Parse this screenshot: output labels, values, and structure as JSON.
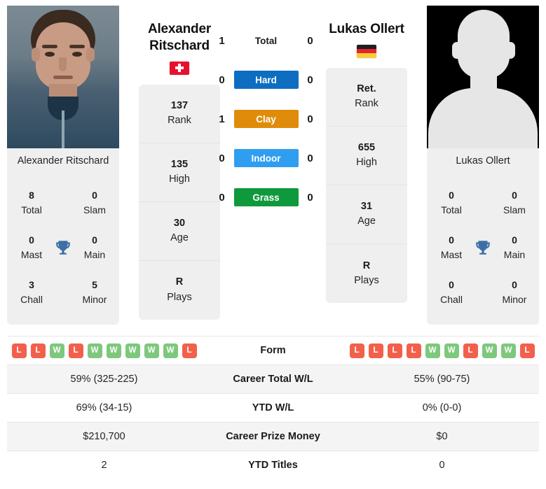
{
  "colors": {
    "hard": "#0d6ec1",
    "clay": "#e08c0a",
    "indoor": "#2f9ef0",
    "grass": "#0e9a3c",
    "win": "#7ec87e",
    "loss": "#f2604c",
    "trophy": "#3d6fa5"
  },
  "player_left": {
    "name_line1": "Alexander",
    "name_line2": "Ritschard",
    "photo_caption": "Alexander Ritschard",
    "flag": "flag-switzerland",
    "stats": [
      {
        "value": "137",
        "label": "Rank"
      },
      {
        "value": "135",
        "label": "High"
      },
      {
        "value": "30",
        "label": "Age"
      },
      {
        "value": "R",
        "label": "Plays"
      }
    ],
    "titles": [
      {
        "value": "8",
        "label": "Total"
      },
      {
        "value": "0",
        "label": "Slam"
      },
      {
        "value": "0",
        "label": "Mast"
      },
      {
        "value": "0",
        "label": "Main"
      },
      {
        "value": "3",
        "label": "Chall"
      },
      {
        "value": "5",
        "label": "Minor"
      }
    ],
    "form": [
      "L",
      "L",
      "W",
      "L",
      "W",
      "W",
      "W",
      "W",
      "W",
      "L"
    ]
  },
  "player_right": {
    "name_line1": "Lukas Ollert",
    "name_line2": "",
    "photo_caption": "Lukas Ollert",
    "flag": "flag-germany",
    "stats": [
      {
        "value": "Ret.",
        "label": "Rank"
      },
      {
        "value": "655",
        "label": "High"
      },
      {
        "value": "31",
        "label": "Age"
      },
      {
        "value": "R",
        "label": "Plays"
      }
    ],
    "titles": [
      {
        "value": "0",
        "label": "Total"
      },
      {
        "value": "0",
        "label": "Slam"
      },
      {
        "value": "0",
        "label": "Mast"
      },
      {
        "value": "0",
        "label": "Main"
      },
      {
        "value": "0",
        "label": "Chall"
      },
      {
        "value": "0",
        "label": "Minor"
      }
    ],
    "form": [
      "L",
      "L",
      "L",
      "L",
      "W",
      "W",
      "L",
      "W",
      "W",
      "L"
    ]
  },
  "h2h": {
    "rows": [
      {
        "left": "1",
        "label": "Total",
        "right": "0",
        "style": "plain",
        "color": ""
      },
      {
        "left": "0",
        "label": "Hard",
        "right": "0",
        "style": "pill",
        "color": "#0d6ec1"
      },
      {
        "left": "1",
        "label": "Clay",
        "right": "0",
        "style": "pill",
        "color": "#e08c0a"
      },
      {
        "left": "0",
        "label": "Indoor",
        "right": "0",
        "style": "pill",
        "color": "#2f9ef0"
      },
      {
        "left": "0",
        "label": "Grass",
        "right": "0",
        "style": "pill",
        "color": "#0e9a3c"
      }
    ]
  },
  "comparison_table": {
    "rows": [
      {
        "label": "Form",
        "left": "",
        "right": "",
        "type": "form",
        "shade": "plain"
      },
      {
        "label": "Career Total W/L",
        "left": "59% (325-225)",
        "right": "55% (90-75)",
        "type": "text",
        "shade": "shade"
      },
      {
        "label": "YTD W/L",
        "left": "69% (34-15)",
        "right": "0% (0-0)",
        "type": "text",
        "shade": "plain"
      },
      {
        "label": "Career Prize Money",
        "left": "$210,700",
        "right": "$0",
        "type": "text",
        "shade": "shade"
      },
      {
        "label": "YTD Titles",
        "left": "2",
        "right": "0",
        "type": "text",
        "shade": "plain"
      }
    ]
  }
}
